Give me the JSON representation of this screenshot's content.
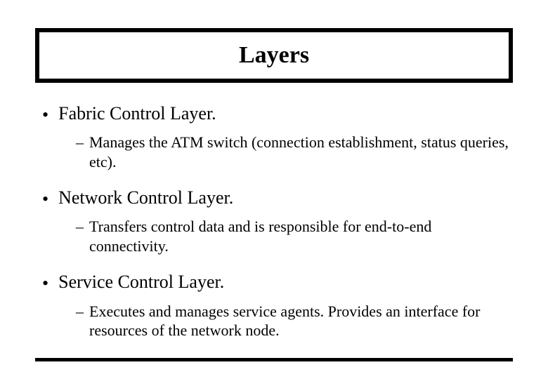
{
  "slide": {
    "title": "Layers",
    "bullets": [
      {
        "text": "Fabric Control Layer.",
        "sub": "Manages the ATM switch (connection establishment, status queries, etc)."
      },
      {
        "text": "Network Control Layer.",
        "sub": "Transfers control data and is responsible for end-to-end connectivity."
      },
      {
        "text": "Service Control Layer.",
        "sub": "Executes and manages service agents. Provides an interface for resources of the network node."
      }
    ]
  }
}
